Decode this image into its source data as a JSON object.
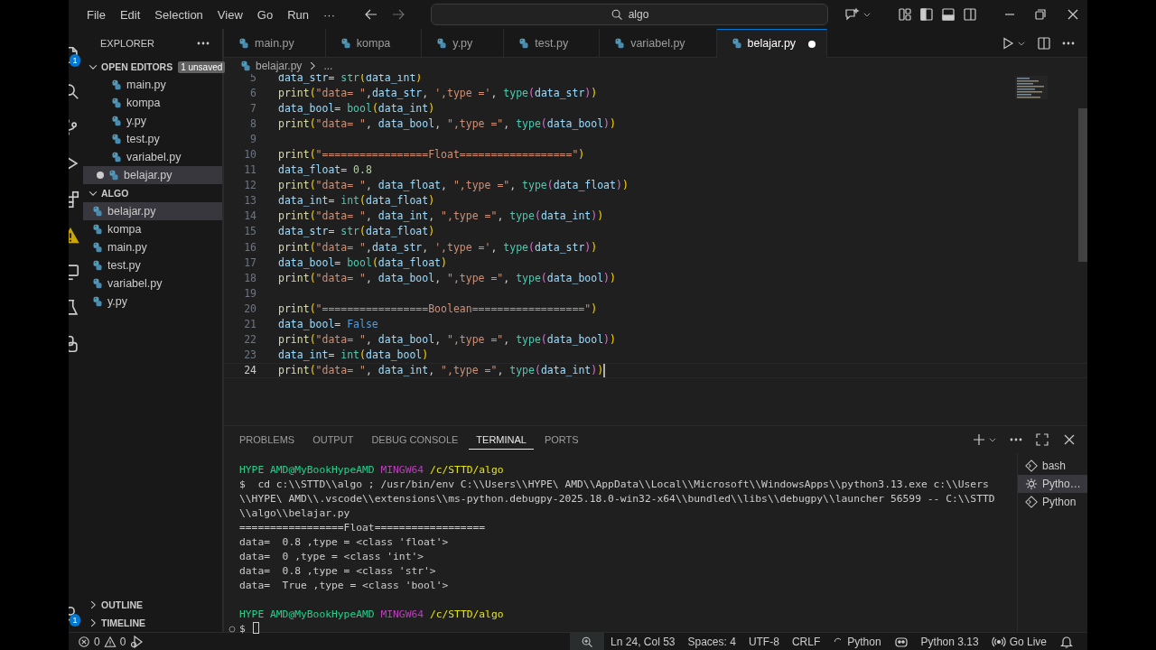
{
  "titlebar": {
    "menu": [
      "File",
      "Edit",
      "Selection",
      "View",
      "Go",
      "Run",
      "···"
    ],
    "search": {
      "value": "algo"
    }
  },
  "activity_bar": {
    "top": [
      {
        "kind": "files",
        "badge": "1"
      },
      {
        "kind": "search"
      },
      {
        "kind": "source-control"
      },
      {
        "kind": "run"
      },
      {
        "kind": "extensions"
      },
      {
        "kind": "warning"
      },
      {
        "kind": "remote"
      },
      {
        "kind": "testing"
      },
      {
        "kind": "python"
      }
    ],
    "bottom": [
      {
        "kind": "account",
        "badge": "1"
      }
    ]
  },
  "sidebar": {
    "title": "EXPLORER",
    "sections": [
      {
        "title": "OPEN EDITORS",
        "expanded": true,
        "badge": "1 unsaved",
        "indent": true,
        "items": [
          {
            "label": "main.py",
            "dirty": false,
            "selected": false
          },
          {
            "label": "kompa",
            "dirty": false,
            "selected": false
          },
          {
            "label": "y.py",
            "dirty": false,
            "selected": false
          },
          {
            "label": "test.py",
            "dirty": false,
            "selected": false
          },
          {
            "label": "variabel.py",
            "dirty": false,
            "selected": false
          },
          {
            "label": "belajar.py",
            "dirty": true,
            "selected": true
          }
        ]
      },
      {
        "title": "ALGO",
        "expanded": true,
        "indent": false,
        "items": [
          {
            "label": "belajar.py",
            "dirty": false,
            "selected": true
          },
          {
            "label": "kompa",
            "dirty": false,
            "selected": false
          },
          {
            "label": "main.py",
            "dirty": false,
            "selected": false
          },
          {
            "label": "test.py",
            "dirty": false,
            "selected": false
          },
          {
            "label": "variabel.py",
            "dirty": false,
            "selected": false
          },
          {
            "label": "y.py",
            "dirty": false,
            "selected": false
          }
        ]
      },
      {
        "title": "OUTLINE",
        "expanded": false
      },
      {
        "title": "TIMELINE",
        "expanded": false
      }
    ]
  },
  "tabs": [
    {
      "label": "main.py",
      "selected": false,
      "dirty": false
    },
    {
      "label": "kompa",
      "selected": false,
      "dirty": false
    },
    {
      "label": "y.py",
      "selected": false,
      "dirty": false
    },
    {
      "label": "test.py",
      "selected": false,
      "dirty": false
    },
    {
      "label": "variabel.py",
      "selected": false,
      "dirty": false
    },
    {
      "label": "belajar.py",
      "selected": true,
      "dirty": true
    }
  ],
  "breadcrumb": [
    "belajar.py",
    "..."
  ],
  "code": [
    {
      "number": "5",
      "current": false,
      "tokens": [
        {
          "kind": "variable",
          "text": "data_str"
        },
        {
          "kind": "punct",
          "text": "= "
        },
        {
          "kind": "builtin",
          "text": "str"
        },
        {
          "kind": "bracket1",
          "text": "("
        },
        {
          "kind": "variable",
          "text": "data_int"
        },
        {
          "kind": "bracket1",
          "text": ")"
        }
      ]
    },
    {
      "number": "6",
      "current": false,
      "tokens": [
        {
          "kind": "function",
          "text": "print"
        },
        {
          "kind": "bracket1",
          "text": "("
        },
        {
          "kind": "string",
          "text": "\"data= \""
        },
        {
          "kind": "punct",
          "text": ","
        },
        {
          "kind": "variable",
          "text": "data_str"
        },
        {
          "kind": "punct",
          "text": ", "
        },
        {
          "kind": "string",
          "text": "',type ='"
        },
        {
          "kind": "punct",
          "text": ", "
        },
        {
          "kind": "builtin",
          "text": "type"
        },
        {
          "kind": "bracket2",
          "text": "("
        },
        {
          "kind": "variable",
          "text": "data_str"
        },
        {
          "kind": "bracket2",
          "text": ")"
        },
        {
          "kind": "bracket1",
          "text": ")"
        }
      ]
    },
    {
      "number": "7",
      "current": false,
      "tokens": [
        {
          "kind": "variable",
          "text": "data_bool"
        },
        {
          "kind": "punct",
          "text": "= "
        },
        {
          "kind": "builtin",
          "text": "bool"
        },
        {
          "kind": "bracket1",
          "text": "("
        },
        {
          "kind": "variable",
          "text": "data_int"
        },
        {
          "kind": "bracket1",
          "text": ")"
        }
      ]
    },
    {
      "number": "8",
      "current": false,
      "tokens": [
        {
          "kind": "function",
          "text": "print"
        },
        {
          "kind": "bracket1",
          "text": "("
        },
        {
          "kind": "string",
          "text": "\"data= \""
        },
        {
          "kind": "punct",
          "text": ", "
        },
        {
          "kind": "variable",
          "text": "data_bool"
        },
        {
          "kind": "punct",
          "text": ", "
        },
        {
          "kind": "string",
          "text": "\",type =\""
        },
        {
          "kind": "punct",
          "text": ", "
        },
        {
          "kind": "builtin",
          "text": "type"
        },
        {
          "kind": "bracket2",
          "text": "("
        },
        {
          "kind": "variable",
          "text": "data_bool"
        },
        {
          "kind": "bracket2",
          "text": ")"
        },
        {
          "kind": "bracket1",
          "text": ")"
        }
      ]
    },
    {
      "number": "9",
      "current": false
    },
    {
      "number": "10",
      "current": false,
      "tokens": [
        {
          "kind": "function",
          "text": "print"
        },
        {
          "kind": "bracket1",
          "text": "("
        },
        {
          "kind": "string",
          "text": "\"=================Float==================\""
        },
        {
          "kind": "bracket1",
          "text": ")"
        }
      ]
    },
    {
      "number": "11",
      "current": false,
      "tokens": [
        {
          "kind": "variable",
          "text": "data_float"
        },
        {
          "kind": "punct",
          "text": "= "
        },
        {
          "kind": "number",
          "text": "0.8"
        }
      ]
    },
    {
      "number": "12",
      "current": false,
      "tokens": [
        {
          "kind": "function",
          "text": "print"
        },
        {
          "kind": "bracket1",
          "text": "("
        },
        {
          "kind": "string",
          "text": "\"data= \""
        },
        {
          "kind": "punct",
          "text": ", "
        },
        {
          "kind": "variable",
          "text": "data_float"
        },
        {
          "kind": "punct",
          "text": ", "
        },
        {
          "kind": "string",
          "text": "\",type =\""
        },
        {
          "kind": "punct",
          "text": ", "
        },
        {
          "kind": "builtin",
          "text": "type"
        },
        {
          "kind": "bracket2",
          "text": "("
        },
        {
          "kind": "variable",
          "text": "data_float"
        },
        {
          "kind": "bracket2",
          "text": ")"
        },
        {
          "kind": "bracket1",
          "text": ")"
        }
      ]
    },
    {
      "number": "13",
      "current": false,
      "tokens": [
        {
          "kind": "variable",
          "text": "data_int"
        },
        {
          "kind": "punct",
          "text": "= "
        },
        {
          "kind": "builtin",
          "text": "int"
        },
        {
          "kind": "bracket1",
          "text": "("
        },
        {
          "kind": "variable",
          "text": "data_float"
        },
        {
          "kind": "bracket1",
          "text": ")"
        }
      ]
    },
    {
      "number": "14",
      "current": false,
      "tokens": [
        {
          "kind": "function",
          "text": "print"
        },
        {
          "kind": "bracket1",
          "text": "("
        },
        {
          "kind": "string",
          "text": "\"data= \""
        },
        {
          "kind": "punct",
          "text": ", "
        },
        {
          "kind": "variable",
          "text": "data_int"
        },
        {
          "kind": "punct",
          "text": ", "
        },
        {
          "kind": "string",
          "text": "\",type =\""
        },
        {
          "kind": "punct",
          "text": ", "
        },
        {
          "kind": "builtin",
          "text": "type"
        },
        {
          "kind": "bracket2",
          "text": "("
        },
        {
          "kind": "variable",
          "text": "data_int"
        },
        {
          "kind": "bracket2",
          "text": ")"
        },
        {
          "kind": "bracket1",
          "text": ")"
        }
      ]
    },
    {
      "number": "15",
      "current": false,
      "tokens": [
        {
          "kind": "variable",
          "text": "data_str"
        },
        {
          "kind": "punct",
          "text": "= "
        },
        {
          "kind": "builtin",
          "text": "str"
        },
        {
          "kind": "bracket1",
          "text": "("
        },
        {
          "kind": "variable",
          "text": "data_float"
        },
        {
          "kind": "bracket1",
          "text": ")"
        }
      ]
    },
    {
      "number": "16",
      "current": false,
      "tokens": [
        {
          "kind": "function",
          "text": "print"
        },
        {
          "kind": "bracket1",
          "text": "("
        },
        {
          "kind": "string",
          "text": "\"data= \""
        },
        {
          "kind": "punct",
          "text": ","
        },
        {
          "kind": "variable",
          "text": "data_str"
        },
        {
          "kind": "punct",
          "text": ", "
        },
        {
          "kind": "string",
          "text": "',type ='"
        },
        {
          "kind": "punct",
          "text": ", "
        },
        {
          "kind": "builtin",
          "text": "type"
        },
        {
          "kind": "bracket2",
          "text": "("
        },
        {
          "kind": "variable",
          "text": "data_str"
        },
        {
          "kind": "bracket2",
          "text": ")"
        },
        {
          "kind": "bracket1",
          "text": ")"
        }
      ]
    },
    {
      "number": "17",
      "current": false,
      "tokens": [
        {
          "kind": "variable",
          "text": "data_bool"
        },
        {
          "kind": "punct",
          "text": "= "
        },
        {
          "kind": "builtin",
          "text": "bool"
        },
        {
          "kind": "bracket1",
          "text": "("
        },
        {
          "kind": "variable",
          "text": "data_float"
        },
        {
          "kind": "bracket1",
          "text": ")"
        }
      ]
    },
    {
      "number": "18",
      "current": false,
      "tokens": [
        {
          "kind": "function",
          "text": "print"
        },
        {
          "kind": "bracket1",
          "text": "("
        },
        {
          "kind": "string",
          "text": "\"data= \""
        },
        {
          "kind": "punct",
          "text": ", "
        },
        {
          "kind": "variable",
          "text": "data_bool"
        },
        {
          "kind": "punct",
          "text": ", "
        },
        {
          "kind": "string",
          "text": "\",type =\""
        },
        {
          "kind": "punct",
          "text": ", "
        },
        {
          "kind": "builtin",
          "text": "type"
        },
        {
          "kind": "bracket2",
          "text": "("
        },
        {
          "kind": "variable",
          "text": "data_bool"
        },
        {
          "kind": "bracket2",
          "text": ")"
        },
        {
          "kind": "bracket1",
          "text": ")"
        }
      ]
    },
    {
      "number": "19",
      "current": false
    },
    {
      "number": "20",
      "current": false,
      "tokens": [
        {
          "kind": "function",
          "text": "print"
        },
        {
          "kind": "bracket1",
          "text": "("
        },
        {
          "kind": "string",
          "text": "\"=================Boolean==================\""
        },
        {
          "kind": "bracket1",
          "text": ")"
        }
      ]
    },
    {
      "number": "21",
      "current": false,
      "tokens": [
        {
          "kind": "variable",
          "text": "data_bool"
        },
        {
          "kind": "punct",
          "text": "= "
        },
        {
          "kind": "constant",
          "text": "False"
        }
      ]
    },
    {
      "number": "22",
      "current": false,
      "tokens": [
        {
          "kind": "function",
          "text": "print"
        },
        {
          "kind": "bracket1",
          "text": "("
        },
        {
          "kind": "string",
          "text": "\"data= \""
        },
        {
          "kind": "punct",
          "text": ", "
        },
        {
          "kind": "variable",
          "text": "data_bool"
        },
        {
          "kind": "punct",
          "text": ", "
        },
        {
          "kind": "string",
          "text": "\",type =\""
        },
        {
          "kind": "punct",
          "text": ", "
        },
        {
          "kind": "builtin",
          "text": "type"
        },
        {
          "kind": "bracket2",
          "text": "("
        },
        {
          "kind": "variable",
          "text": "data_bool"
        },
        {
          "kind": "bracket2",
          "text": ")"
        },
        {
          "kind": "bracket1",
          "text": ")"
        }
      ]
    },
    {
      "number": "23",
      "current": false,
      "tokens": [
        {
          "kind": "variable",
          "text": "data_int"
        },
        {
          "kind": "punct",
          "text": "= "
        },
        {
          "kind": "builtin",
          "text": "int"
        },
        {
          "kind": "bracket1",
          "text": "("
        },
        {
          "kind": "variable",
          "text": "data_bool"
        },
        {
          "kind": "bracket1",
          "text": ")"
        }
      ]
    },
    {
      "number": "24",
      "current": true,
      "tokens": [
        {
          "kind": "function",
          "text": "print"
        },
        {
          "kind": "bracket1",
          "text": "("
        },
        {
          "kind": "string",
          "text": "\"data= \""
        },
        {
          "kind": "punct",
          "text": ", "
        },
        {
          "kind": "variable",
          "text": "data_int"
        },
        {
          "kind": "punct",
          "text": ", "
        },
        {
          "kind": "string",
          "text": "\",type =\""
        },
        {
          "kind": "punct",
          "text": ", "
        },
        {
          "kind": "builtin",
          "text": "type"
        },
        {
          "kind": "bracket2",
          "text": "("
        },
        {
          "kind": "variable",
          "text": "data_int"
        },
        {
          "kind": "bracket2",
          "text": ")"
        },
        {
          "kind": "bracket1",
          "text": ")"
        }
      ]
    }
  ],
  "panel": {
    "tabs": [
      {
        "label": "PROBLEMS",
        "selected": false
      },
      {
        "label": "OUTPUT",
        "selected": false
      },
      {
        "label": "DEBUG CONSOLE",
        "selected": false
      },
      {
        "label": "TERMINAL",
        "selected": true
      },
      {
        "label": "PORTS",
        "selected": false
      }
    ],
    "terminal": [
      {
        "kind": "prompt",
        "user": "HYPE AMD@MyBookHypeAMD",
        "shell": "MINGW64",
        "path": "/c/STTD/algo"
      },
      {
        "kind": "command",
        "text": "$  cd c:\\\\STTD\\\\algo ; /usr/bin/env C:\\\\Users\\\\HYPE\\ AMD\\\\AppData\\\\Local\\\\Microsoft\\\\WindowsApps\\\\python3.13.exe c:\\\\Users\\\\HYPE\\ AMD\\\\.vscode\\\\extensions\\\\ms-python.debugpy-2025.18.0-win32-x64\\\\bundled\\\\libs\\\\debugpy\\\\launcher 56599 -- C:\\\\STTD\\\\algo\\\\belajar.py"
      },
      {
        "kind": "output",
        "text": "=================Float=================="
      },
      {
        "kind": "output",
        "text": "data=  0.8 ,type = <class 'float'>"
      },
      {
        "kind": "output",
        "text": "data=  0 ,type = <class 'int'>"
      },
      {
        "kind": "output",
        "text": "data=  0.8 ,type = <class 'str'>"
      },
      {
        "kind": "output",
        "text": "data=  True ,type = <class 'bool'>"
      },
      {
        "kind": "blank"
      },
      {
        "kind": "prompt",
        "user": "HYPE AMD@MyBookHypeAMD",
        "shell": "MINGW64",
        "path": "/c/STTD/algo"
      },
      {
        "kind": "input",
        "text": "$"
      }
    ],
    "terminals": [
      {
        "label": "bash",
        "kind": "shell",
        "selected": false
      },
      {
        "label": "Pytho…",
        "kind": "debug",
        "selected": true
      },
      {
        "label": "Python",
        "kind": "shell",
        "selected": false
      }
    ]
  },
  "status_bar": {
    "left": [
      {
        "kind": "errors",
        "text": "0"
      },
      {
        "kind": "warnings",
        "text": "0"
      },
      {
        "kind": "debug"
      }
    ],
    "right": [
      {
        "kind": "zoom"
      },
      {
        "kind": "plain",
        "text": "Ln 24, Col 53"
      },
      {
        "kind": "plain",
        "text": "Spaces: 4"
      },
      {
        "kind": "plain",
        "text": "UTF-8"
      },
      {
        "kind": "plain",
        "text": "CRLF"
      },
      {
        "kind": "language",
        "text": "Python"
      },
      {
        "kind": "copilot"
      },
      {
        "kind": "plain",
        "text": "Python 3.13"
      },
      {
        "kind": "live",
        "text": "Go Live"
      },
      {
        "kind": "bell"
      }
    ]
  }
}
